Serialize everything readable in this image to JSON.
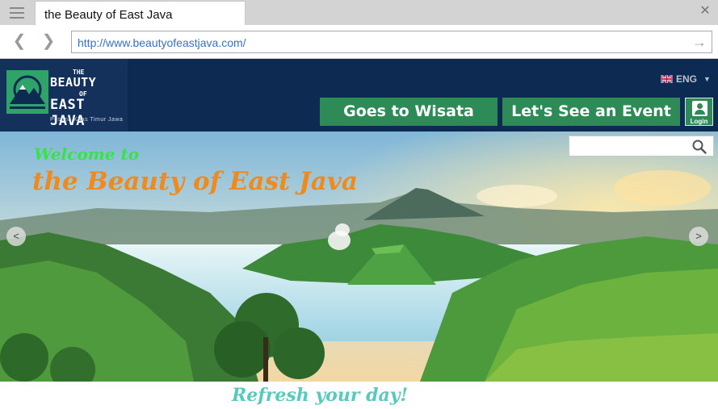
{
  "browser": {
    "tab_title": "the Beauty of East Java",
    "url": "http://www.beautyofeastjava.com/"
  },
  "site": {
    "logo": {
      "line1": "THE",
      "line2": "BEAUTY",
      "line3": "OF",
      "line4": "EAST JAVA",
      "tagline": "Pesona Khas Timur Jawa"
    },
    "language": "ENG",
    "nav": {
      "wisata_label": "Goes to Wisata",
      "event_label": "Let's See an Event",
      "login_label": "Login"
    },
    "hero": {
      "welcome": "Welcome to",
      "headline": "the Beauty of East Java",
      "prev_label": "<",
      "next_label": ">",
      "search_placeholder": ""
    },
    "tagline": "Refresh your day!"
  },
  "colors": {
    "header_bg": "#0c2a52",
    "button_green": "#2e8b57",
    "welcome_green": "#39e24a",
    "headline_orange": "#f08a1c",
    "tagline_teal": "#5bc8be"
  }
}
